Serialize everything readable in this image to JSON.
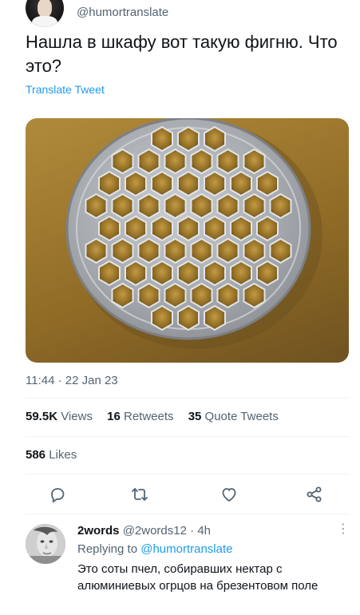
{
  "tweet": {
    "handle": "@humortranslate",
    "text": "Нашла в шкафу вот такую фигню. Что это?",
    "translate_label": "Translate Tweet",
    "timestamp": "11:44 · 22 Jan 23"
  },
  "stats": {
    "views_count": "59.5K",
    "views_label": "Views",
    "retweets_count": "16",
    "retweets_label": "Retweets",
    "quotes_count": "35",
    "quotes_label": "Quote Tweets",
    "likes_count": "586",
    "likes_label": "Likes"
  },
  "actions": [
    {
      "icon": "reply-icon"
    },
    {
      "icon": "retweet-icon"
    },
    {
      "icon": "like-icon"
    },
    {
      "icon": "share-icon"
    }
  ],
  "reply": {
    "name": "2words",
    "handle": "@2words12",
    "separator": "·",
    "time": "4h",
    "replying_prefix": "Replying to",
    "replying_to": "@humortranslate",
    "text": "Это соты пчел, собиравших нектар с алюминиевых огрцов на брезентовом поле"
  },
  "colors": {
    "link": "#1d9bf0",
    "secondary_text": "#536471",
    "primary_text": "#0f1419"
  }
}
